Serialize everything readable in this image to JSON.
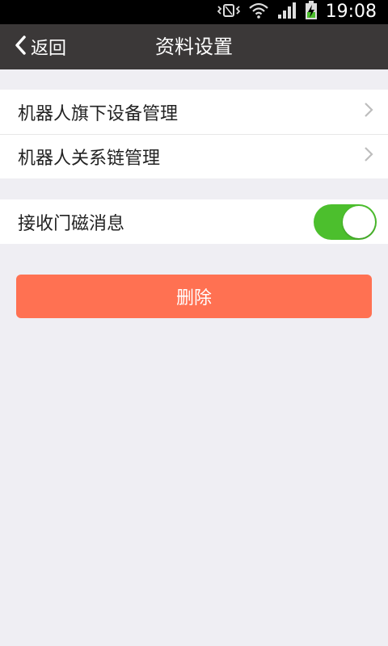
{
  "status_bar": {
    "time": "19:08",
    "icons": [
      "vibrate-icon",
      "wifi-icon",
      "signal-icon",
      "battery-charging-icon"
    ]
  },
  "nav": {
    "back_label": "返回",
    "title": "资料设置"
  },
  "menu_group": {
    "items": [
      {
        "label": "机器人旗下设备管理"
      },
      {
        "label": "机器人关系链管理"
      }
    ]
  },
  "settings_group": {
    "door_sensor_label": "接收门磁消息",
    "door_sensor_enabled": true
  },
  "actions": {
    "delete_label": "删除"
  },
  "colors": {
    "nav_bg": "#3b3838",
    "page_bg": "#efeef3",
    "toggle_on": "#4cbf2d",
    "delete_bg": "#ff7152"
  }
}
